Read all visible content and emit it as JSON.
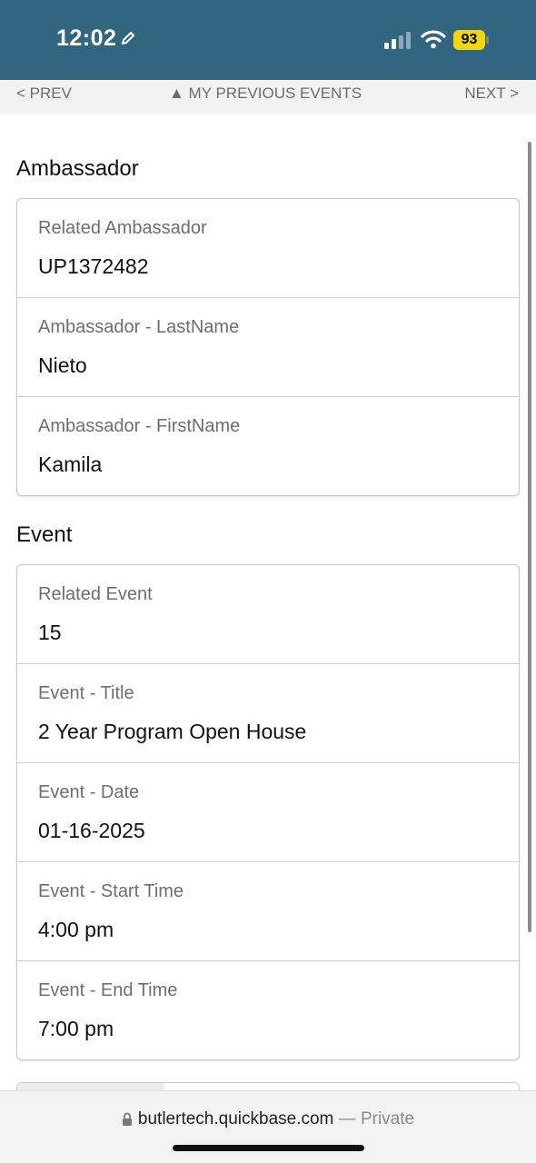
{
  "status_bar": {
    "time": "12:02",
    "battery": "93",
    "icons": [
      "pencil-icon",
      "signal-icon",
      "wifi-icon",
      "battery-icon"
    ]
  },
  "nav": {
    "prev": "< PREV",
    "center": "▲ MY PREVIOUS EVENTS",
    "next": "NEXT >"
  },
  "sections": {
    "ambassador": {
      "title": "Ambassador",
      "fields": [
        {
          "label": "Related Ambassador",
          "value": "UP1372482"
        },
        {
          "label": "Ambassador - LastName",
          "value": "Nieto"
        },
        {
          "label": "Ambassador - FirstName",
          "value": "Kamila"
        }
      ]
    },
    "event": {
      "title": "Event",
      "fields": [
        {
          "label": "Related Event",
          "value": "15"
        },
        {
          "label": "Event - Title",
          "value": "2 Year Program Open House"
        },
        {
          "label": "Event - Date",
          "value": "01-16-2025"
        },
        {
          "label": "Event - Start Time",
          "value": "4:00 pm"
        },
        {
          "label": "Event - End Time",
          "value": "7:00 pm"
        }
      ]
    }
  },
  "url_bar": {
    "domain": "butlertech.quickbase.com",
    "separator": "—",
    "mode": "Private"
  },
  "colors": {
    "status_bar_bg": "#316580",
    "battery": "#f5d60a",
    "nav_bg": "#f2f2f2"
  }
}
